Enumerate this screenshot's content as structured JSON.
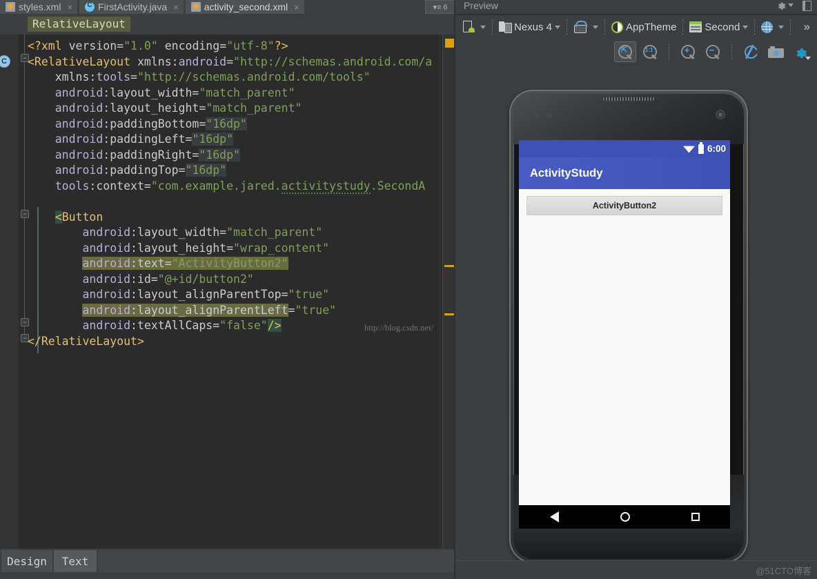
{
  "editor": {
    "tabs": [
      {
        "label": "styles.xml",
        "icon": "xml-file-icon",
        "active": false
      },
      {
        "label": "FirstActivity.java",
        "icon": "java-file-icon",
        "active": false
      },
      {
        "label": "activity_second.xml",
        "icon": "xml-file-icon",
        "active": true
      }
    ],
    "tab_close_glyph": "×",
    "tab_overflow_label": "▾≡ 6",
    "breadcrumb": "RelativeLayout",
    "gutter_marker": "C",
    "watermark": "http://blog.csdn.net/",
    "code_lines": [
      {
        "tokens": [
          {
            "t": "<?xml ",
            "c": "t-proc"
          },
          {
            "t": "version",
            "c": "t-name"
          },
          {
            "t": "=",
            "c": "t-eq"
          },
          {
            "t": "\"1.0\"",
            "c": "t-val"
          },
          {
            "t": " ",
            "c": "t-name"
          },
          {
            "t": "encoding",
            "c": "t-name"
          },
          {
            "t": "=",
            "c": "t-eq"
          },
          {
            "t": "\"utf-8\"",
            "c": "t-val"
          },
          {
            "t": "?>",
            "c": "t-proc"
          }
        ]
      },
      {
        "tokens": [
          {
            "t": "<RelativeLayout",
            "c": "t-tag"
          },
          {
            "t": " ",
            "c": "t-name"
          },
          {
            "t": "xmlns:",
            "c": "t-name"
          },
          {
            "t": "android",
            "c": "t-attr"
          },
          {
            "t": "=",
            "c": "t-eq"
          },
          {
            "t": "\"http://schemas.android.com/a",
            "c": "t-val"
          }
        ]
      },
      {
        "tokens": [
          {
            "t": "    xmlns:",
            "c": "t-name"
          },
          {
            "t": "tools",
            "c": "t-attr"
          },
          {
            "t": "=",
            "c": "t-eq"
          },
          {
            "t": "\"http://schemas.android.com/tools\"",
            "c": "t-val"
          }
        ]
      },
      {
        "tokens": [
          {
            "t": "    android",
            "c": "t-attr"
          },
          {
            "t": ":layout_width",
            "c": "t-name"
          },
          {
            "t": "=",
            "c": "t-eq"
          },
          {
            "t": "\"match_parent\"",
            "c": "t-val"
          }
        ]
      },
      {
        "tokens": [
          {
            "t": "    android",
            "c": "t-attr"
          },
          {
            "t": ":layout_height",
            "c": "t-name"
          },
          {
            "t": "=",
            "c": "t-eq"
          },
          {
            "t": "\"match_parent\"",
            "c": "t-val"
          }
        ]
      },
      {
        "tokens": [
          {
            "t": "    android",
            "c": "t-attr"
          },
          {
            "t": ":paddingBottom",
            "c": "t-name"
          },
          {
            "t": "=",
            "c": "t-eq"
          },
          {
            "t": "\"16dp\"",
            "c": "t-val hl-grey"
          }
        ]
      },
      {
        "tokens": [
          {
            "t": "    android",
            "c": "t-attr"
          },
          {
            "t": ":paddingLeft",
            "c": "t-name"
          },
          {
            "t": "=",
            "c": "t-eq"
          },
          {
            "t": "\"16dp\"",
            "c": "t-val hl-grey"
          }
        ]
      },
      {
        "tokens": [
          {
            "t": "    android",
            "c": "t-attr"
          },
          {
            "t": ":paddingRight",
            "c": "t-name"
          },
          {
            "t": "=",
            "c": "t-eq"
          },
          {
            "t": "\"16dp\"",
            "c": "t-val hl-grey"
          }
        ]
      },
      {
        "tokens": [
          {
            "t": "    android",
            "c": "t-attr"
          },
          {
            "t": ":paddingTop",
            "c": "t-name"
          },
          {
            "t": "=",
            "c": "t-eq"
          },
          {
            "t": "\"16dp\"",
            "c": "t-val hl-grey"
          }
        ]
      },
      {
        "tokens": [
          {
            "t": "    tools",
            "c": "t-attr"
          },
          {
            "t": ":context",
            "c": "t-name"
          },
          {
            "t": "=",
            "c": "t-eq"
          },
          {
            "t": "\"com.example.jared.",
            "c": "t-val"
          },
          {
            "t": "activitystudy",
            "c": "t-val squiggle"
          },
          {
            "t": ".SecondA",
            "c": "t-val"
          }
        ]
      },
      {
        "tokens": []
      },
      {
        "tokens": [
          {
            "t": "    ",
            "c": "t-name"
          },
          {
            "t": "<",
            "c": "t-tag hl-green"
          },
          {
            "t": "Button",
            "c": "t-tag"
          }
        ]
      },
      {
        "tokens": [
          {
            "t": "        android",
            "c": "t-attr"
          },
          {
            "t": ":layout_width",
            "c": "t-name"
          },
          {
            "t": "=",
            "c": "t-eq"
          },
          {
            "t": "\"match_parent\"",
            "c": "t-val"
          }
        ]
      },
      {
        "tokens": [
          {
            "t": "        android",
            "c": "t-attr"
          },
          {
            "t": ":layout_height",
            "c": "t-name"
          },
          {
            "t": "=",
            "c": "t-eq"
          },
          {
            "t": "\"wrap_content\"",
            "c": "t-val"
          }
        ]
      },
      {
        "tokens": [
          {
            "t": "        ",
            "c": "t-name"
          },
          {
            "t": "android",
            "c": "t-attr hl-olive"
          },
          {
            "t": ":text",
            "c": "t-name hl-olive"
          },
          {
            "t": "=",
            "c": "t-eq hl-olive"
          },
          {
            "t": "\"ActivityButton2\"",
            "c": "t-val hl-olive"
          }
        ]
      },
      {
        "tokens": [
          {
            "t": "        android",
            "c": "t-attr"
          },
          {
            "t": ":id",
            "c": "t-name"
          },
          {
            "t": "=",
            "c": "t-eq"
          },
          {
            "t": "\"@+id/button2\"",
            "c": "t-val"
          }
        ]
      },
      {
        "tokens": [
          {
            "t": "        android",
            "c": "t-attr"
          },
          {
            "t": ":layout_alignParentTop",
            "c": "t-name"
          },
          {
            "t": "=",
            "c": "t-eq"
          },
          {
            "t": "\"true\"",
            "c": "t-val"
          }
        ]
      },
      {
        "tokens": [
          {
            "t": "        ",
            "c": "t-name"
          },
          {
            "t": "android",
            "c": "t-attr hl-olive"
          },
          {
            "t": ":layout_alignParentLeft",
            "c": "t-name hl-olive"
          },
          {
            "t": "=",
            "c": "t-eq"
          },
          {
            "t": "\"true\"",
            "c": "t-val"
          }
        ]
      },
      {
        "tokens": [
          {
            "t": "        android",
            "c": "t-attr"
          },
          {
            "t": ":textAllCaps",
            "c": "t-name"
          },
          {
            "t": "=",
            "c": "t-eq"
          },
          {
            "t": "\"false\"",
            "c": "t-val"
          },
          {
            "t": "/>",
            "c": "t-tag hl-green"
          }
        ]
      },
      {
        "tokens": [
          {
            "t": "</RelativeLayout>",
            "c": "t-tag"
          }
        ]
      }
    ],
    "bottom_tabs": [
      {
        "label": "Design",
        "active": false
      },
      {
        "label": "Text",
        "active": true
      }
    ]
  },
  "preview": {
    "panel_title": "Preview",
    "toolbar": {
      "device_config_label": "",
      "device_label": "Nexus 4",
      "orientation_label": "",
      "theme_label": "AppTheme",
      "activity_label": "Second",
      "locale_label": "",
      "overflow_label": "»",
      "icons": [
        "android-document-icon",
        "device-icon",
        "orientation-icon",
        "theme-icon",
        "activity-layout-icon",
        "globe-icon"
      ]
    },
    "zoom_toolbar": {
      "buttons": [
        {
          "name": "zoom-to-fit-icon",
          "label": "",
          "selected": true
        },
        {
          "name": "zoom-actual-size-icon",
          "label": "1:1",
          "selected": false
        },
        {
          "name": "zoom-in-icon",
          "label": "+",
          "selected": false
        },
        {
          "name": "zoom-out-icon",
          "label": "−",
          "selected": false
        },
        {
          "name": "refresh-icon",
          "label": "",
          "selected": false
        },
        {
          "name": "screenshot-camera-icon",
          "label": "",
          "selected": false
        },
        {
          "name": "preview-settings-gear-icon",
          "label": "",
          "selected": false
        }
      ]
    },
    "device": {
      "status_bar": {
        "clock": "6:00",
        "wifi": "wifi-icon",
        "battery": "battery-icon"
      },
      "app_bar_title": "ActivityStudy",
      "button_label": "ActivityButton2",
      "nav": [
        "back-nav-icon",
        "home-nav-icon",
        "recents-nav-icon"
      ]
    },
    "watermark": "@51CTO博客"
  },
  "colors": {
    "editor_bg": "#2b2b2b",
    "chrome_bg": "#3c3f41",
    "gutter_bg": "#313335",
    "tag": "#e8bf6a",
    "attr": "#bdaed8",
    "value": "#7fa05a",
    "highlight_olive": "#6b6b42",
    "android_indigo": "#3f51b5",
    "accent_blue": "#5c9fd6",
    "android_green": "#a4c639",
    "marker_orange": "#d9a300"
  }
}
